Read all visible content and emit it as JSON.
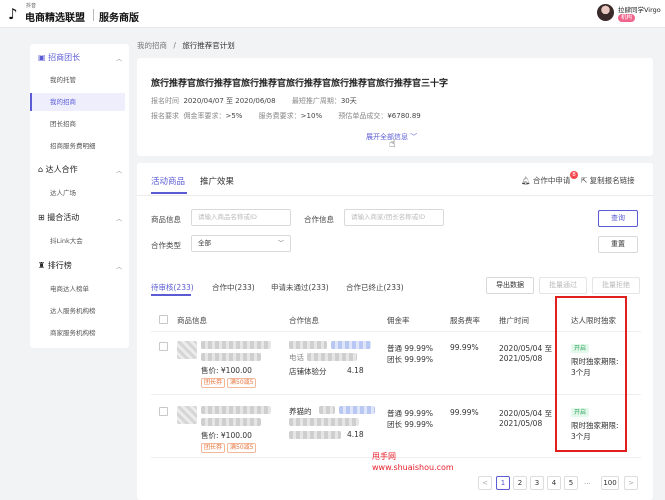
{
  "header": {
    "logo_small": "抖音",
    "logo_text": "电商精选联盟",
    "logo_sub": "服务商版",
    "user_name": "拉肆同学Virgo",
    "user_badge": "机构"
  },
  "sidebar": {
    "groups": [
      {
        "label": "招商团长",
        "items": [
          "我的托管",
          "我的招商",
          "团长招商",
          "招商服务费明细"
        ]
      },
      {
        "label": "达人合作",
        "items": [
          "达人广场"
        ]
      },
      {
        "label": "撮合活动",
        "items": [
          "抖Link大会"
        ]
      },
      {
        "label": "排行榜",
        "items": [
          "电商达人榜单",
          "达人服务机构榜",
          "商家服务机构榜"
        ]
      }
    ]
  },
  "breadcrumb": {
    "root": "我的招商",
    "sep": "/",
    "current": "旅行推荐官计划"
  },
  "plan": {
    "title": "旅行推荐官旅行推荐官旅行推荐官旅行推荐官旅行推荐官旅行推荐官三十字",
    "time_label": "报名时间",
    "time_value": "2020/04/07 至 2020/06/08",
    "period_label": "最短推广周期：",
    "period_value": "30天",
    "req_label": "报名要求",
    "commission_label": "佣金率要求：",
    "commission_value": ">5%",
    "fee_label": "服务费要求：",
    "fee_value": ">10%",
    "deal_label": "预估单品成交：",
    "deal_value": "¥6780.89",
    "expand": "展开全部信息"
  },
  "tabs": {
    "active": "活动商品",
    "other": "推广效果"
  },
  "top_links": {
    "applying": "合作中申请",
    "applying_count": "8",
    "copy": "复制报名链接"
  },
  "filters": {
    "product_label": "商品信息",
    "product_placeholder": "请输入商品名称或ID",
    "partner_label": "合作信息",
    "partner_placeholder": "请输入商家/团长名称或ID",
    "type_label": "合作类型",
    "type_value": "全部",
    "search_btn": "查询",
    "reset_btn": "重置"
  },
  "status_tabs": [
    "待审核(233)",
    "合作中(233)",
    "申请未通过(233)",
    "合作已终止(233)"
  ],
  "actions": {
    "export": "导出数据",
    "batch_pass": "批量通过",
    "batch_reject": "批量拒绝"
  },
  "table": {
    "headers": [
      "商品信息",
      "合作信息",
      "佣金率",
      "服务费率",
      "推广时间",
      "达人限时独家"
    ],
    "rows": [
      {
        "price": "售价: ¥100.00",
        "tag1": "团长券",
        "tag2": "满50减5",
        "partner_prefix": "电话",
        "shop": "店铺体验分",
        "score": "4.18",
        "comm1": "普通 99.99%",
        "comm2": "团长 99.99%",
        "fee": "99.99%",
        "time1": "2020/05/04 至",
        "time2": "2021/05/08",
        "excl_tag": "开启",
        "excl1": "限时独家期限:",
        "excl2": "3个月"
      },
      {
        "price": "售价: ¥100.00",
        "tag1": "团长券",
        "tag2": "满50减5",
        "partner_prefix": "养猫的",
        "shop": "",
        "score": "4.18",
        "comm1": "普通 99.99%",
        "comm2": "团长 99.99%",
        "fee": "99.99%",
        "time1": "2020/05/04 至",
        "time2": "2021/05/08",
        "excl_tag": "开启",
        "excl1": "限时独家期限:",
        "excl2": "3个月"
      }
    ]
  },
  "watermark": {
    "line1": "甩手网",
    "line2": "www.shuaishou.com"
  },
  "pagination": {
    "prev": "<",
    "pages": [
      "1",
      "2",
      "3",
      "4",
      "5"
    ],
    "ellipsis": "...",
    "last": "100",
    "next": ">"
  }
}
